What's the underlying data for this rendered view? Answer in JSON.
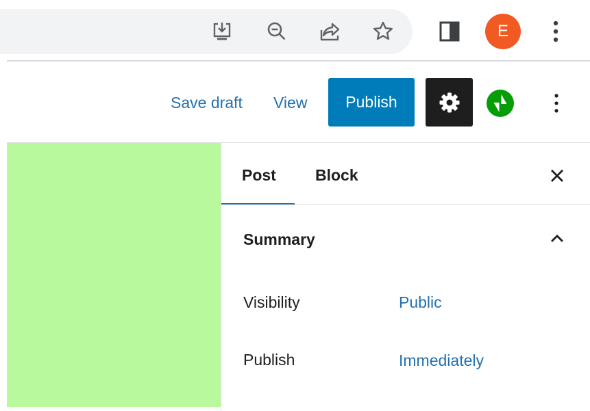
{
  "browser": {
    "icons": [
      "install-app-icon",
      "zoom-out-icon",
      "share-icon",
      "bookmark-star-icon",
      "side-panel-icon",
      "chrome-menu-icon"
    ],
    "profile_initial": "E",
    "profile_color": "#f25a24"
  },
  "header": {
    "save_draft_label": "Save draft",
    "view_label": "View",
    "publish_label": "Publish",
    "accent_color": "#007cba"
  },
  "sidebar": {
    "tabs": [
      {
        "label": "Post",
        "active": true
      },
      {
        "label": "Block",
        "active": false
      }
    ],
    "panel": {
      "title": "Summary",
      "rows": [
        {
          "label": "Visibility",
          "value": "Public"
        },
        {
          "label": "Publish",
          "value": "Immediately"
        }
      ]
    }
  },
  "canvas": {
    "background_color": "#b9f99d"
  }
}
